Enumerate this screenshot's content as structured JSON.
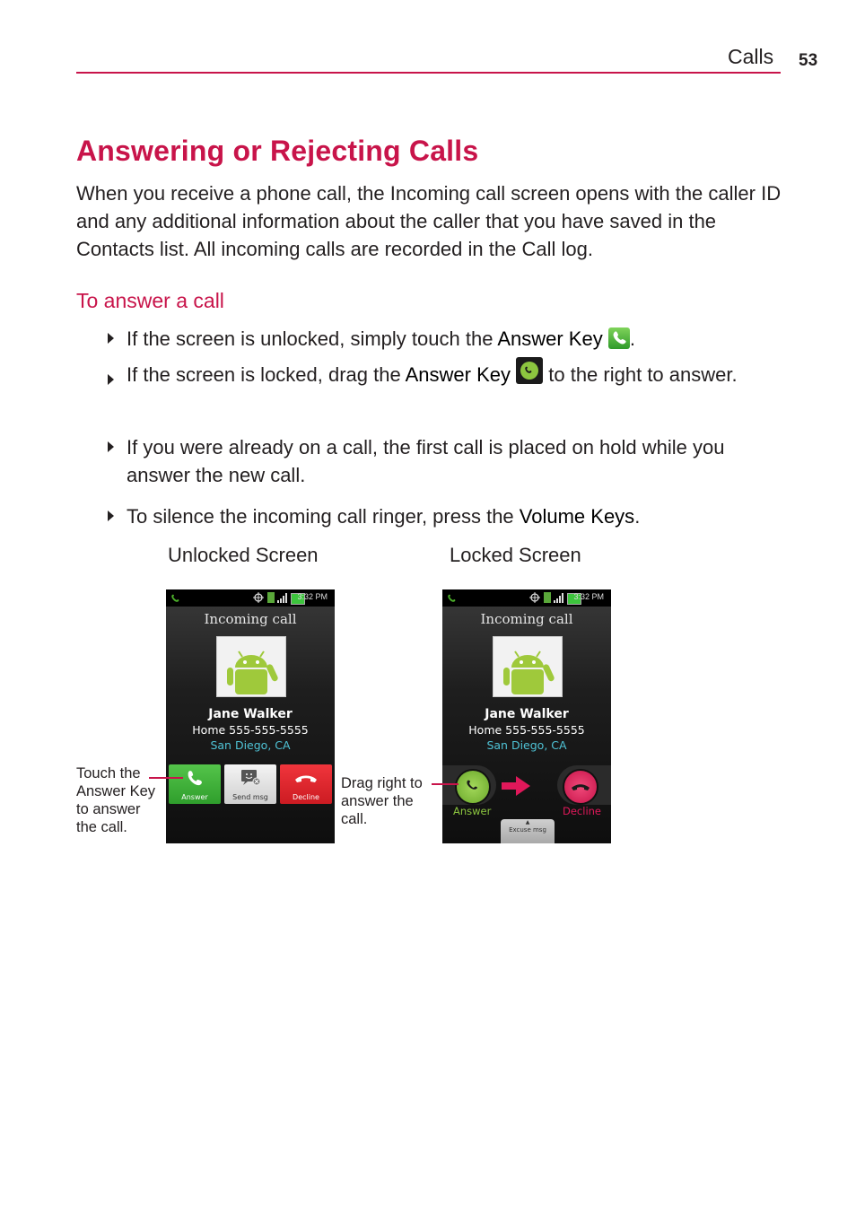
{
  "header": {
    "section": "Calls",
    "page_number": "53"
  },
  "title": "Answering or Rejecting Calls",
  "intro": "When you receive a phone call, the Incoming call screen opens with the caller ID and any additional information about the caller that you have saved in the Contacts list. All incoming calls are recorded in the Call log.",
  "subheading": "To answer a call",
  "bullets": [
    {
      "before": "If the screen is unlocked, simply touch the ",
      "key": "Answer Key",
      "after": ".",
      "icon": "green-phone-answer-icon"
    },
    {
      "before": "If the screen is locked, drag the ",
      "key": "Answer Key",
      "after": " to the right to answer.",
      "icon": "round-green-answer-icon"
    },
    {
      "before": "If you were already on a call, the first call is placed on hold while you answer the new call.",
      "key": "",
      "after": ""
    },
    {
      "before": "To silence the incoming call ringer, press the ",
      "key": "Volume Keys",
      "after": "."
    }
  ],
  "figures": {
    "unlocked": {
      "caption": "Unlocked Screen",
      "status_time": "3:32 PM",
      "screen_title": "Incoming call",
      "contact_name": "Jane Walker",
      "contact_number": "Home 555-555-5555",
      "contact_location": "San Diego, CA",
      "buttons": [
        "Answer",
        "Send msg",
        "Decline"
      ],
      "callout_line1": "Touch the",
      "callout_key": "Answer Key",
      "callout_line3": "to answer",
      "callout_line4": "the call."
    },
    "locked": {
      "caption": "Locked Screen",
      "status_time": "3:32 PM",
      "screen_title": "Incoming call",
      "contact_name": "Jane Walker",
      "contact_number": "Home 555-555-5555",
      "contact_location": "San Diego, CA",
      "answer_label": "Answer",
      "decline_label": "Decline",
      "excuse_label": "Excuse msg",
      "callout_line1": "Drag right to",
      "callout_line2": "answer the",
      "callout_line3": "call."
    }
  },
  "colors": {
    "accent": "#c8144a",
    "answer_green": "#3fb23a",
    "decline_red": "#e0232b",
    "lock_answer_green": "#8cc63f",
    "lock_decline_pink": "#e0185a",
    "location_cyan": "#4fc3d6"
  }
}
